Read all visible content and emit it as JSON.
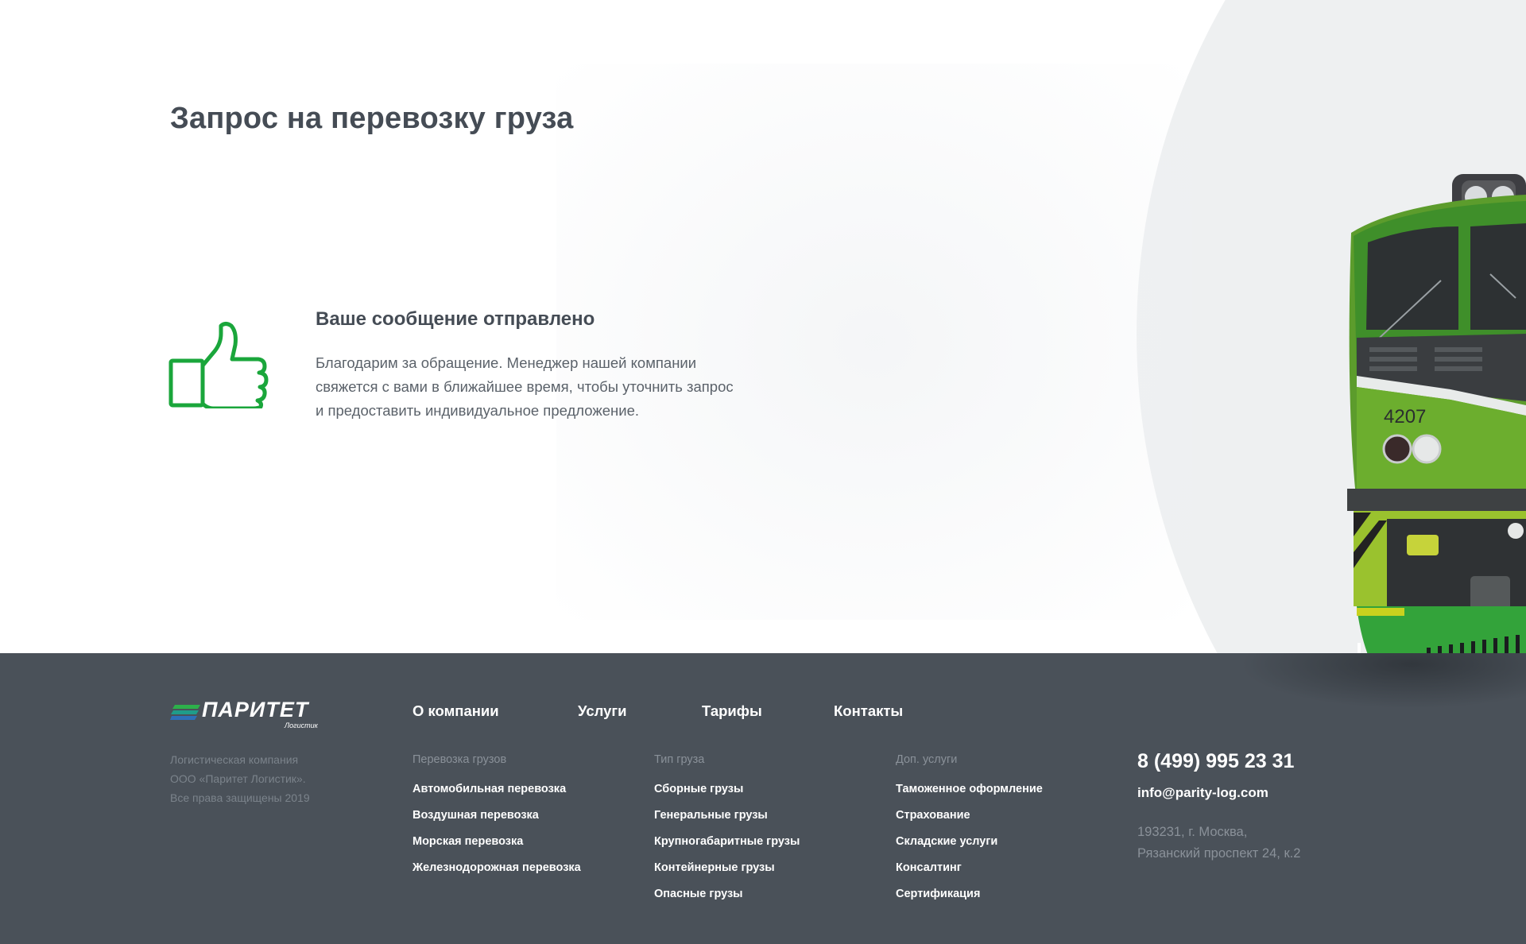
{
  "hero": {
    "title": "Запрос на перевозку груза",
    "message": {
      "title": "Ваше сообщение отправлено",
      "lines": [
        "Благодарим за обращение. Менеджер нашей компании",
        "свяжется с вами в ближайшее время, чтобы уточнить запрос",
        "и предоставить индивидуальное предложение."
      ]
    },
    "train_number": "4207"
  },
  "footer": {
    "logo": {
      "name": "ПАРИТЕТ",
      "sub": "Логистик"
    },
    "legal": [
      "Логистическая компания",
      "ООО «Паритет Логистик».",
      "Все права защищены 2019"
    ],
    "nav": [
      "О компании",
      "Услуги",
      "Тарифы",
      "Контакты"
    ],
    "columns": [
      {
        "heading": "Перевозка грузов",
        "items": [
          "Автомобильная перевозка",
          "Воздушная перевозка",
          "Морская перевозка",
          "Железнодорожная перевозка"
        ]
      },
      {
        "heading": "Тип груза",
        "items": [
          "Сборные грузы",
          "Генеральные грузы",
          "Крупногабаритные грузы",
          "Контейнерные грузы",
          "Опасные грузы"
        ]
      },
      {
        "heading": "Доп. услуги",
        "items": [
          "Таможенное оформление",
          "Страхование",
          "Складские услуги",
          "Консалтинг",
          "Сертификация"
        ]
      }
    ],
    "contacts": {
      "phone": "8 (499) 995 23 31",
      "email": "info@parity-log.com",
      "address": [
        "193231, г. Москва,",
        "Рязанский проспект 24, к.2"
      ]
    }
  },
  "colors": {
    "accent_green": "#1aa63b",
    "footer_bg": "#4a5159",
    "text_dark": "#454c55"
  }
}
